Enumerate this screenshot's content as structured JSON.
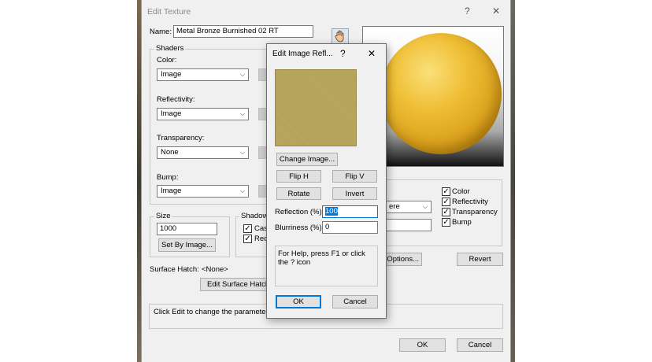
{
  "main_dialog": {
    "title": "Edit Texture",
    "help_icon": "?",
    "close_icon": "✕",
    "name_label": "Name:",
    "name_value": "Metal Bronze Burnished 02 RT",
    "shaders_group": "Shaders",
    "color_label": "Color:",
    "color_value": "Image",
    "reflectivity_label": "Reflectivity:",
    "reflectivity_value": "Image",
    "transparency_label": "Transparency:",
    "transparency_value": "None",
    "bump_label": "Bump:",
    "bump_value": "Image",
    "size_group": "Size",
    "size_value": "1000",
    "set_by_image": "Set By Image...",
    "shadows_group": "Shadows",
    "shadow_cast_partial": "Cast",
    "shadow_receive_partial": "Rece",
    "preview_shape_partial": "ere",
    "options_partial": "Options...",
    "revert": "Revert",
    "checkboxes": [
      {
        "label": "Color",
        "checked": true
      },
      {
        "label": "Reflectivity",
        "checked": true
      },
      {
        "label": "Transparency",
        "checked": true
      },
      {
        "label": "Bump",
        "checked": true
      }
    ],
    "surface_hatch_label": "Surface Hatch:",
    "surface_hatch_value": "<None>",
    "edit_surface_hatch": "Edit Surface Hatch...",
    "status_text": "Click Edit to change the parameters of",
    "ok": "OK",
    "cancel": "Cancel"
  },
  "sub_dialog": {
    "title": "Edit Image Refl...",
    "help_icon": "?",
    "close_icon": "✕",
    "change_image": "Change Image...",
    "flip_h": "Flip H",
    "flip_v": "Flip V",
    "rotate": "Rotate",
    "invert": "Invert",
    "reflection_label": "Reflection (%):",
    "reflection_value": "100",
    "blurriness_label": "Blurriness (%):",
    "blurriness_value": "0",
    "help_text": "For Help, press F1 or click the ? icon",
    "ok": "OK",
    "cancel": "Cancel"
  },
  "colors": {
    "dialog_bg": "#f0f0f0",
    "swatch": "#b8a45a",
    "sphere": "#e8b830",
    "selection": "#0078d7"
  },
  "icons": {
    "hand": "hand-icon",
    "chevron": "chevron-down-icon",
    "check": "check-icon"
  }
}
